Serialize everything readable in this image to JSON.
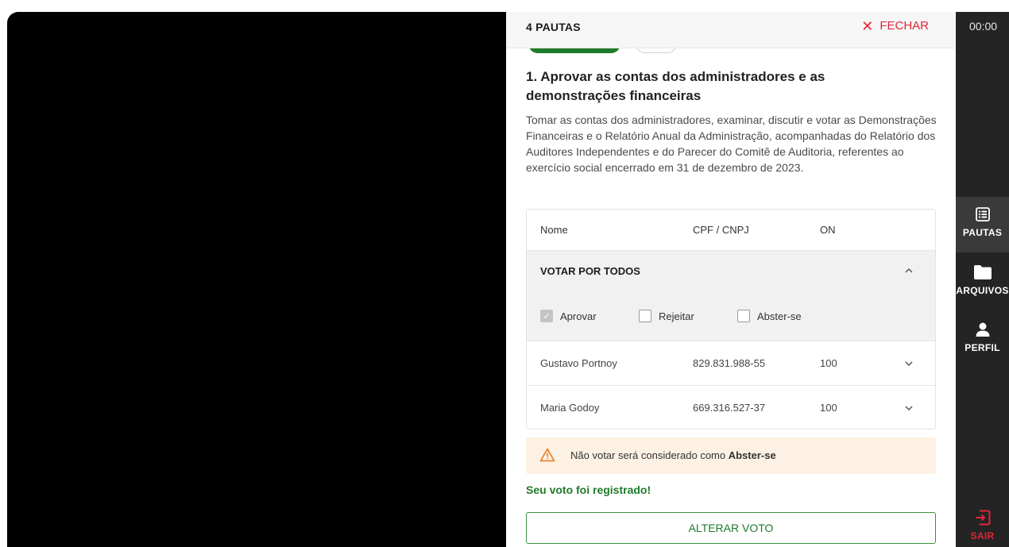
{
  "timer": "00:00",
  "panel": {
    "title": "4 PAUTAS",
    "close_label": "FECHAR",
    "item_title": "1. Aprovar as contas dos administradores e as demonstrações financeiras",
    "item_description": "Tomar as contas dos administradores, examinar, discutir e votar as Demonstrações Financeiras e o Relatório Anual da Administração, acompanhadas do Relatório dos Auditores Independentes e do Parecer do Comitê de Auditoria, referentes ao exercício social encerrado em 31 de dezembro de 2023."
  },
  "table": {
    "headers": [
      "Nome",
      "CPF / CNPJ",
      "ON"
    ],
    "vote_all_label": "VOTAR POR TODOS",
    "options": [
      {
        "label": "Aprovar",
        "checked": true
      },
      {
        "label": "Rejeitar",
        "checked": false
      },
      {
        "label": "Abster-se",
        "checked": false
      }
    ],
    "rows": [
      {
        "name": "Gustavo Portnoy",
        "doc": "829.831.988-55",
        "on": "100"
      },
      {
        "name": "Maria Godoy",
        "doc": "669.316.527-37",
        "on": "100"
      }
    ]
  },
  "warning": {
    "prefix": "Não votar será considerado como ",
    "emphasis": "Abster-se"
  },
  "status_message": "Seu voto foi registrado!",
  "change_vote_label": "ALTERAR VOTO",
  "rail": {
    "items": [
      {
        "label": "PAUTAS",
        "icon": "list-icon",
        "active": true
      },
      {
        "label": "ARQUIVOS",
        "icon": "folder-icon",
        "active": false
      },
      {
        "label": "PERFIL",
        "icon": "user-icon",
        "active": false
      }
    ],
    "exit_label": "SAIR",
    "exit_icon": "exit-icon"
  },
  "colors": {
    "accent_green": "#1f7a2a",
    "danger_red": "#e0263a",
    "rail_bg": "#242424",
    "warning_bg": "#fdf1e3"
  }
}
